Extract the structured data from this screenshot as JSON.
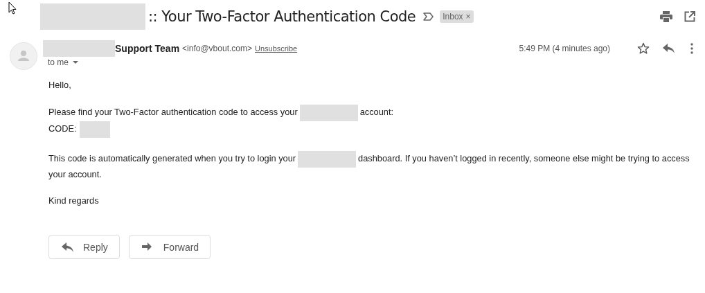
{
  "subject": {
    "segments": [
      {
        "kind": "redacted"
      },
      {
        "kind": "text",
        "text": ":: Your Two-Factor Authentication Code"
      }
    ],
    "label": "Inbox",
    "label_close": "×"
  },
  "sender": {
    "segments": [
      {
        "kind": "redacted"
      },
      {
        "kind": "text",
        "text": "Support Team"
      }
    ],
    "email": "<info@vbout.com>",
    "unsubscribe": "Unsubscribe",
    "recipient": "to me",
    "time": "5:49 PM (4 minutes ago)",
    "starred": false
  },
  "body": [
    [
      {
        "kind": "text",
        "text": "Hello,"
      }
    ],
    [
      {
        "kind": "text",
        "text": "Please find your Two-Factor authentication code to access your"
      },
      {
        "kind": "redacted"
      },
      {
        "kind": "text",
        "text": "account:"
      }
    ],
    [
      {
        "kind": "text",
        "text": "CODE:"
      },
      {
        "kind": "redacted"
      }
    ],
    [
      {
        "kind": "text",
        "text": "This code is automatically generated when you try to login your"
      },
      {
        "kind": "redacted"
      },
      {
        "kind": "text",
        "text": "dashboard. If you haven’t logged in recently, someone else might be trying to access"
      }
    ],
    [
      {
        "kind": "text",
        "text": "your account."
      }
    ],
    [
      {
        "kind": "text",
        "text": "Kind regards"
      }
    ]
  ],
  "actions": [
    {
      "kind": "reply",
      "label": "Reply"
    },
    {
      "kind": "forward",
      "label": "Forward"
    }
  ]
}
